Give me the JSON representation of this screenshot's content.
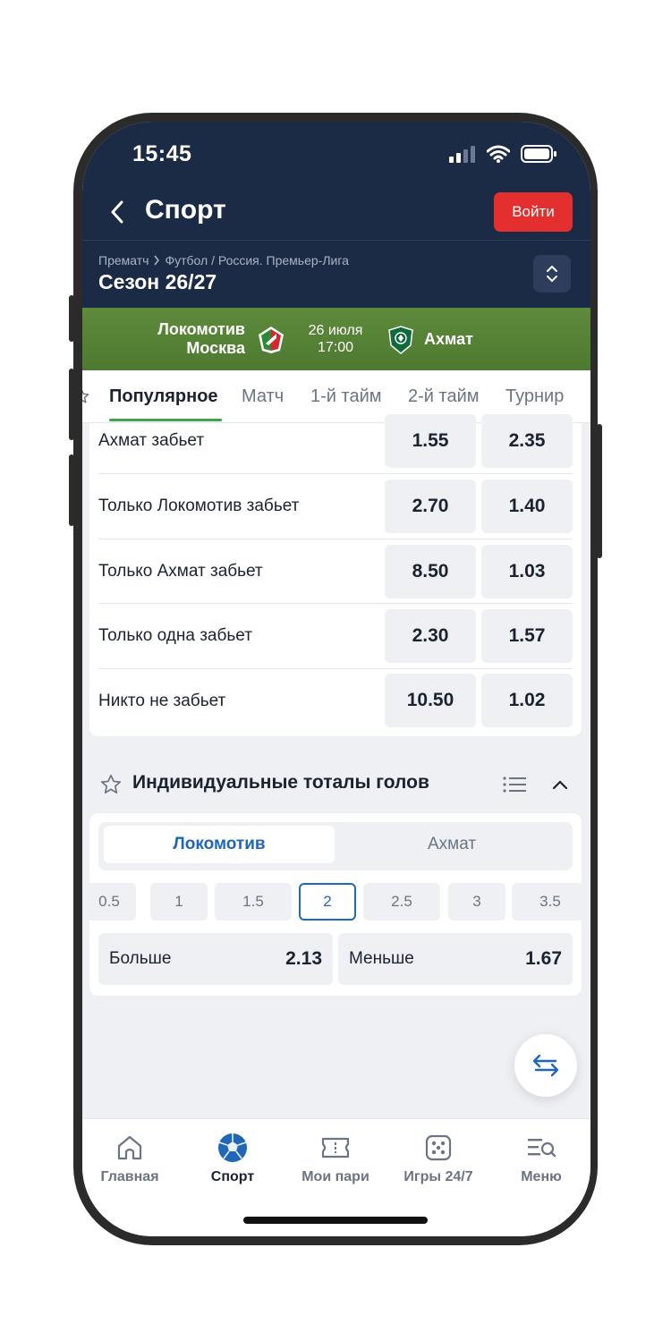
{
  "status_bar": {
    "time": "15:45"
  },
  "header": {
    "title": "Спорт",
    "login_label": "Войти",
    "breadcrumb": [
      "Прематч",
      "Футбол / Россия. Премьер-Лига"
    ],
    "season": "Сезон 26/27"
  },
  "match": {
    "home_line1": "Локомотив",
    "home_line2": "Москва",
    "date": "26 июля",
    "time": "17:00",
    "away": "Ахмат",
    "colors": {
      "banner": "#56823a"
    }
  },
  "tabs": [
    {
      "label": "Популярное",
      "active": true
    },
    {
      "label": "Матч"
    },
    {
      "label": "1-й тайм"
    },
    {
      "label": "2-й тайм"
    },
    {
      "label": "Турнир"
    }
  ],
  "market_rows": [
    {
      "label": "Ахмат забьет",
      "odd1": "1.55",
      "odd2": "2.35"
    },
    {
      "label": "Только Локомотив забьет",
      "odd1": "2.70",
      "odd2": "1.40"
    },
    {
      "label": "Только Ахмат забьет",
      "odd1": "8.50",
      "odd2": "1.03"
    },
    {
      "label": "Только одна забьет",
      "odd1": "2.30",
      "odd2": "1.57"
    },
    {
      "label": "Никто не забьет",
      "odd1": "10.50",
      "odd2": "1.02"
    }
  ],
  "totals_section": {
    "title": "Индивидуальные тоталы голов",
    "teams": [
      "Локомотив",
      "Ахмат"
    ],
    "selected_team": "Локомотив",
    "lines": [
      "0.5",
      "1",
      "1.5",
      "2",
      "2.5",
      "3",
      "3.5"
    ],
    "selected_line": "2",
    "over_label": "Больше",
    "over_odd": "2.13",
    "under_label": "Меньше",
    "under_odd": "1.67"
  },
  "bottom_nav": [
    {
      "label": "Главная",
      "icon": "home-icon"
    },
    {
      "label": "Спорт",
      "icon": "soccer-ball-icon",
      "active": true
    },
    {
      "label": "Мои пари",
      "icon": "ticket-icon"
    },
    {
      "label": "Игры 24/7",
      "icon": "dice-icon"
    },
    {
      "label": "Меню",
      "icon": "menu-search-icon"
    }
  ],
  "colors": {
    "accent": "#2167b8",
    "login": "#e42f2f",
    "header": "#1b2a45",
    "tab_underline": "#3fa34d"
  }
}
